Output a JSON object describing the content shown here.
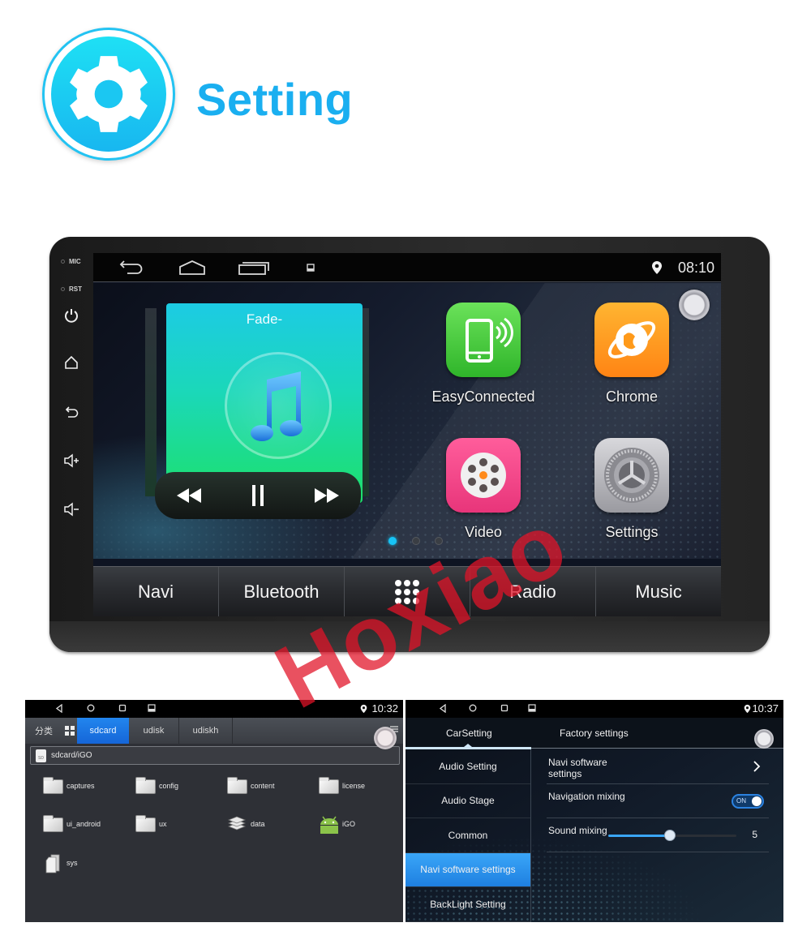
{
  "header": {
    "title": "Setting",
    "icon": "gear-icon",
    "accent_color": "#1aaff0"
  },
  "watermark": "Hoxiao",
  "head_unit": {
    "side_labels": {
      "mic": "MIC",
      "rst": "RST"
    },
    "side_buttons": [
      "power-icon",
      "home-icon",
      "back-icon",
      "volume-up-icon",
      "volume-down-icon"
    ],
    "status_bar": {
      "nav_icons": [
        "back-icon",
        "home-icon",
        "recent-apps-icon",
        "screenshot-icon"
      ],
      "location_icon": "location-pin-icon",
      "time": "08:10"
    },
    "music_widget": {
      "title": "Fade-",
      "controls": [
        "rewind-icon",
        "pause-icon",
        "fast-forward-icon"
      ]
    },
    "apps": [
      {
        "label": "EasyConnected",
        "icon": "phone-connect-icon",
        "color": "#4ccf3c"
      },
      {
        "label": "Chrome",
        "icon": "globe-icon",
        "color": "#ff9a1a"
      },
      {
        "label": "Video",
        "icon": "film-reel-icon",
        "color": "#f0498a"
      },
      {
        "label": "Settings",
        "icon": "settings-gear-icon",
        "color": "#b8b8bc"
      }
    ],
    "pager": {
      "pages": 3,
      "current": 1
    },
    "dock": [
      {
        "label": "Navi"
      },
      {
        "label": "Bluetooth"
      },
      {
        "label": "",
        "icon": "app-grid-icon"
      },
      {
        "label": "Radio"
      },
      {
        "label": "Music"
      }
    ]
  },
  "file_manager": {
    "status_bar": {
      "time": "10:32"
    },
    "tabs": {
      "category": "分类",
      "items": [
        "sdcard",
        "udisk",
        "udiskh"
      ],
      "active": "sdcard"
    },
    "path": "sdcard/iGO",
    "files": [
      {
        "name": "captures",
        "type": "folder"
      },
      {
        "name": "config",
        "type": "folder"
      },
      {
        "name": "content",
        "type": "folder"
      },
      {
        "name": "license",
        "type": "folder"
      },
      {
        "name": "ui_android",
        "type": "folder"
      },
      {
        "name": "ux",
        "type": "folder"
      },
      {
        "name": "data",
        "type": "stack"
      },
      {
        "name": "iGO",
        "type": "android-app"
      },
      {
        "name": "sys",
        "type": "file"
      }
    ]
  },
  "car_settings": {
    "status_bar": {
      "time": "10:37"
    },
    "top_tabs": [
      "CarSetting",
      "Factory settings"
    ],
    "active_top_tab": "CarSetting",
    "menu": [
      "Audio Setting",
      "Audio Stage",
      "Common",
      "Navi software settings",
      "BackLight Setting"
    ],
    "active_menu": "Navi software settings",
    "rows": {
      "navi_software": {
        "label": "Navi software settings"
      },
      "navigation_mixing": {
        "label": "Navigation mixing",
        "toggle_text": "ON",
        "enabled": true
      },
      "sound_mixing": {
        "label": "Sound mixing",
        "value": "5",
        "fraction": 0.48
      }
    }
  }
}
